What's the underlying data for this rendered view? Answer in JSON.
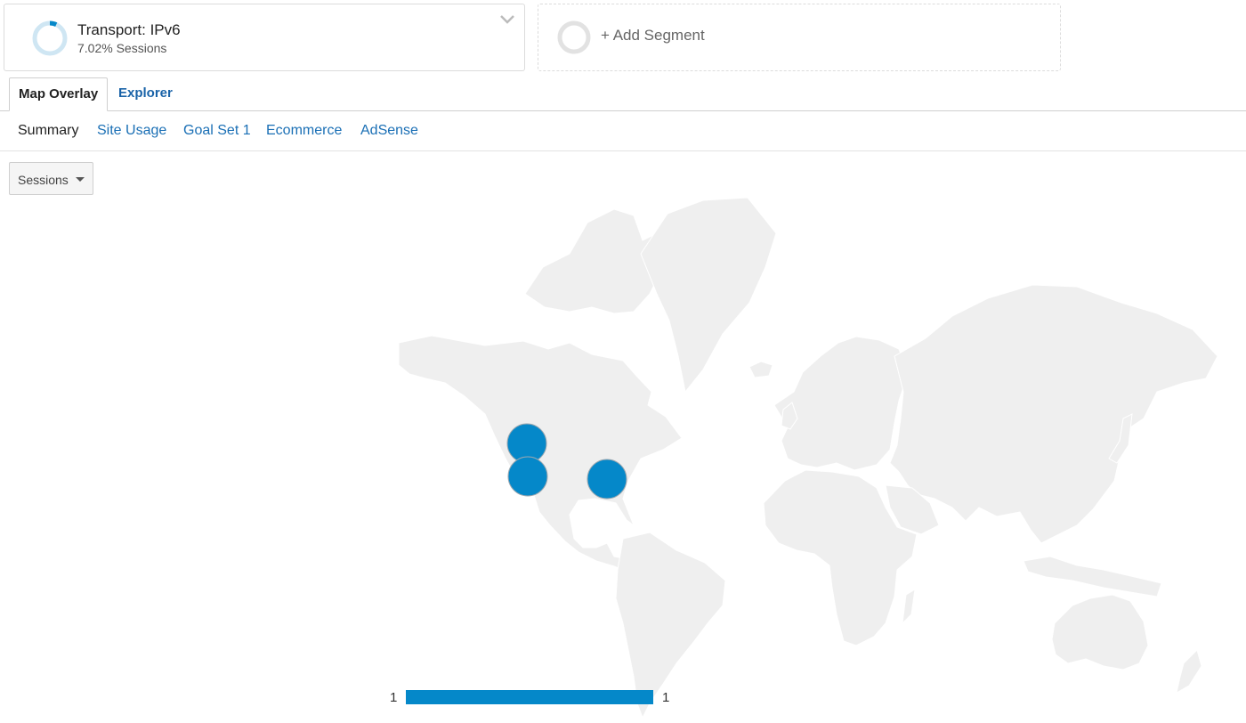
{
  "segments": {
    "active": {
      "title": "Transport: IPv6",
      "subtitle": "7.02% Sessions",
      "percent": 7.02,
      "ring_color": "#0588c9",
      "ring_track_color": "#cfe6f3"
    },
    "add_label": "+ Add Segment"
  },
  "view_tabs": [
    {
      "label": "Map Overlay",
      "active": true
    },
    {
      "label": "Explorer",
      "active": false
    }
  ],
  "subnav": [
    {
      "label": "Summary",
      "active": true
    },
    {
      "label": "Site Usage",
      "active": false
    },
    {
      "label": "Goal Set 1",
      "active": false
    },
    {
      "label": "Ecommerce",
      "active": false
    },
    {
      "label": "AdSense",
      "active": false
    }
  ],
  "metric_selector": {
    "value": "Sessions"
  },
  "map": {
    "land_color": "#efefef",
    "border_color": "#ffffff",
    "bubble_color": "#0588c9",
    "bubbles": [
      {
        "region": "northwest-us",
        "sessions": 1
      },
      {
        "region": "california",
        "sessions": 1
      },
      {
        "region": "southeast-us",
        "sessions": 1
      }
    ]
  },
  "legend": {
    "min": "1",
    "max": "1",
    "color": "#0588c9"
  },
  "icons": {
    "segment_ring": "donut-ring-icon",
    "dropdown": "chevron-down-icon",
    "add_ring": "empty-ring-icon",
    "select_caret": "caret-down-icon"
  }
}
